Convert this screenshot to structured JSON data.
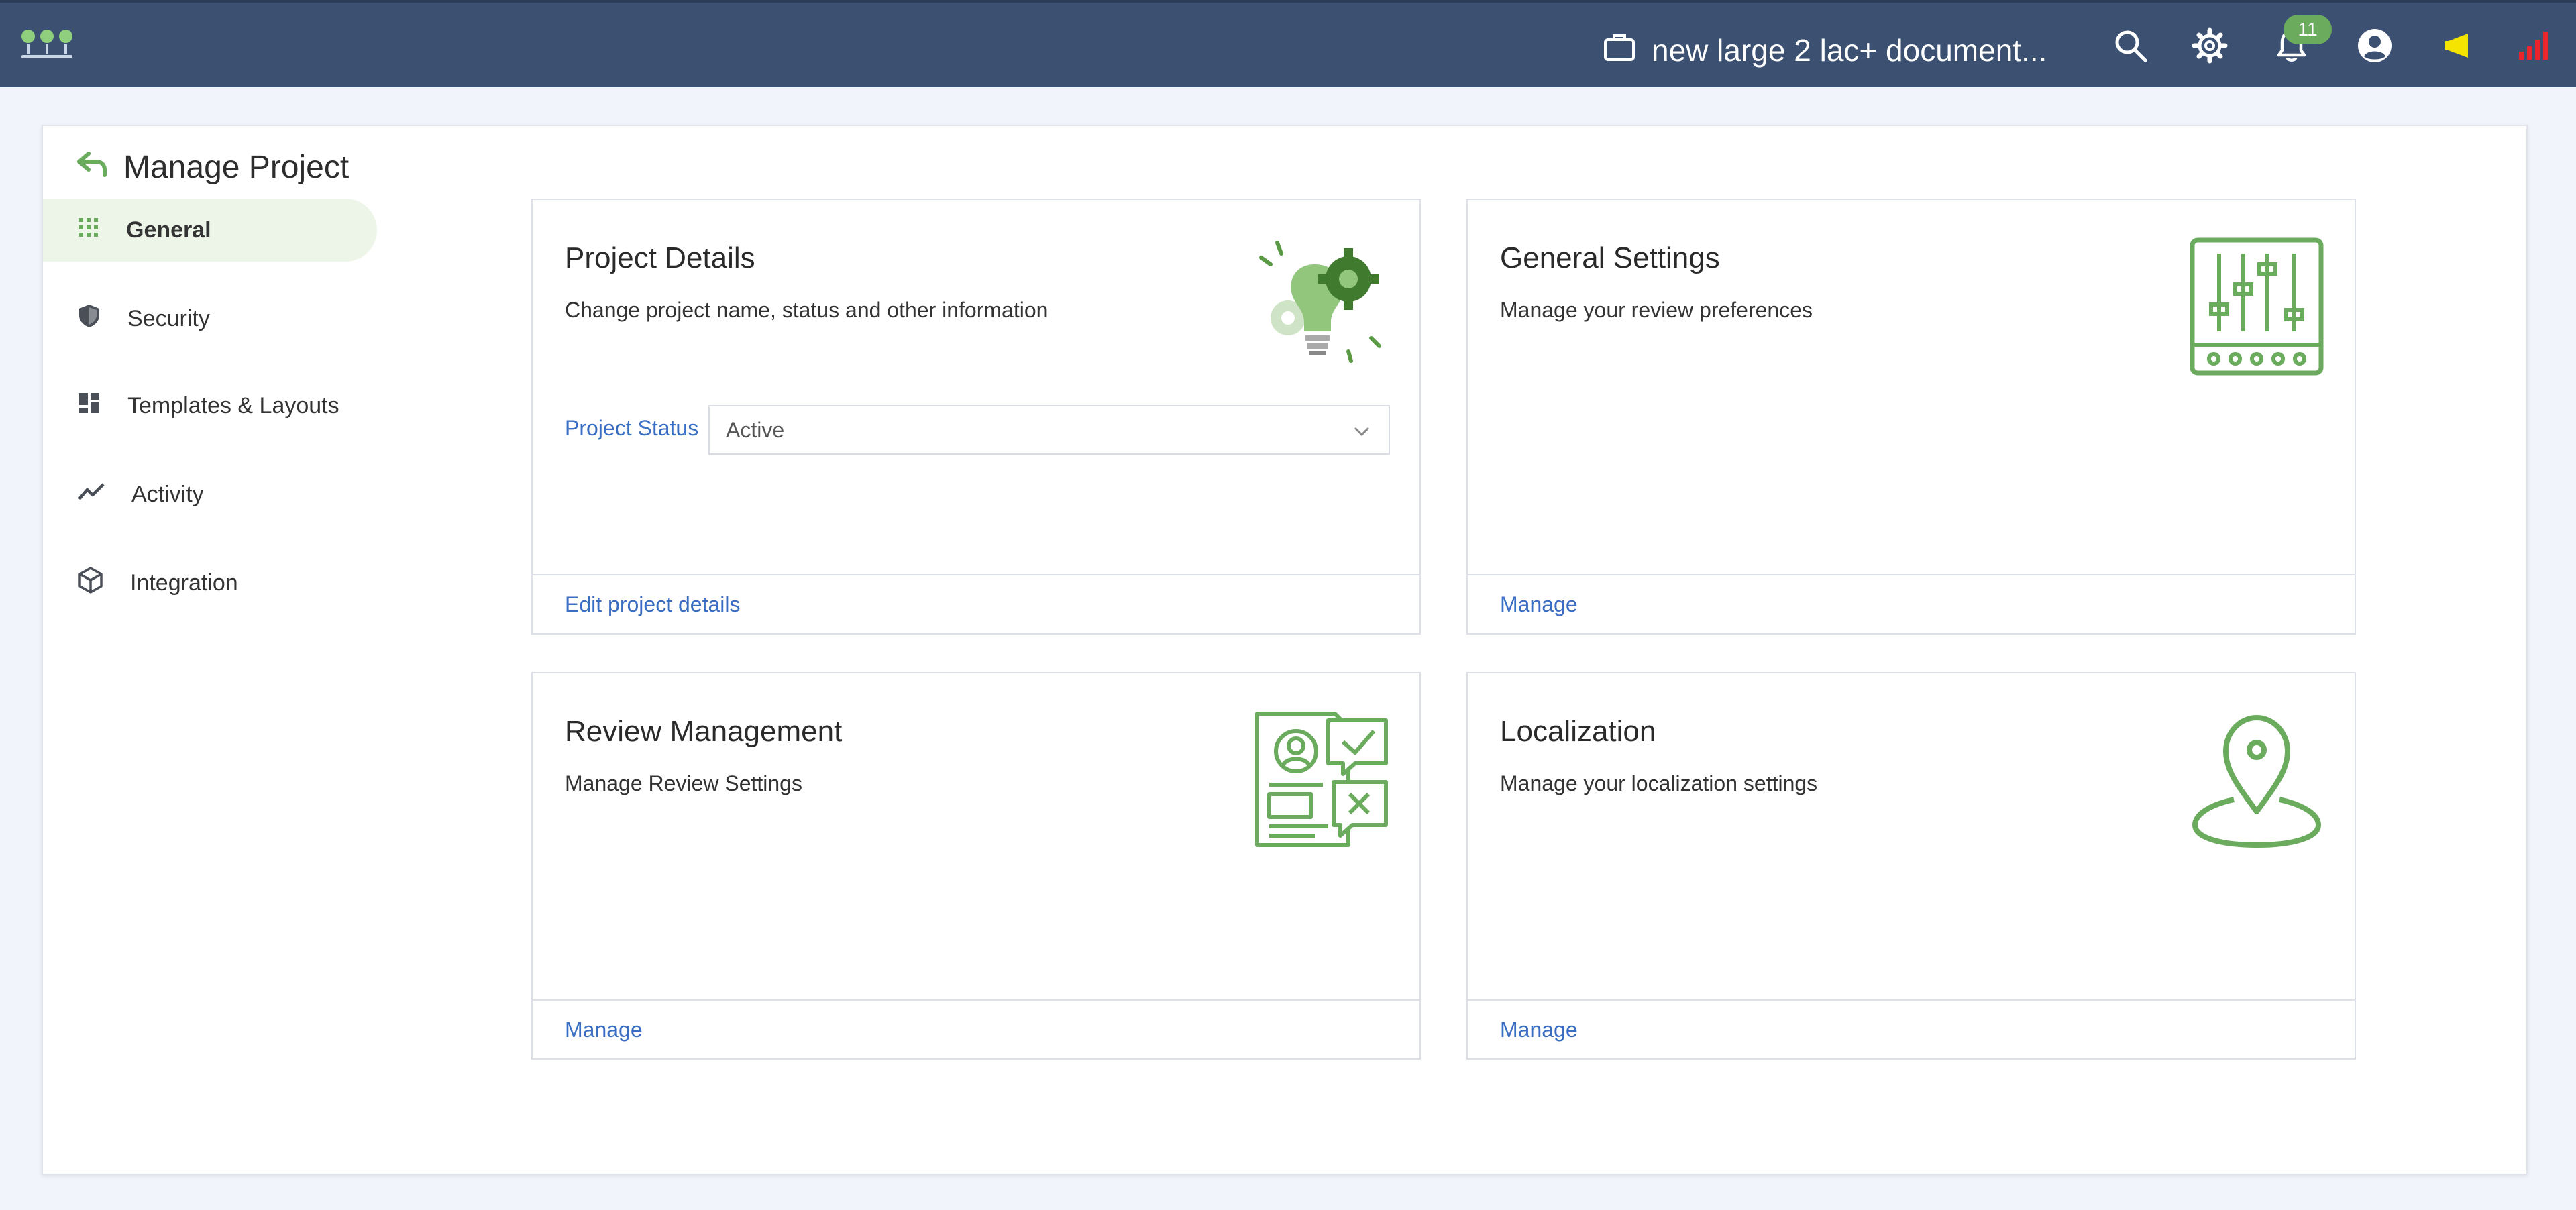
{
  "topbar": {
    "project_name": "new large 2 lac+ document...",
    "notification_count": "11",
    "icons": [
      "logo-icon",
      "briefcase-icon",
      "search-icon",
      "gear-icon",
      "bell-icon",
      "user-icon",
      "megaphone-icon",
      "signal-icon"
    ]
  },
  "page": {
    "title": "Manage Project"
  },
  "sidebar": {
    "items": [
      {
        "label": "General",
        "icon": "grid-icon",
        "active": true
      },
      {
        "label": "Security",
        "icon": "shield-icon"
      },
      {
        "label": "Templates & Layouts",
        "icon": "layout-icon"
      },
      {
        "label": "Activity",
        "icon": "activity-icon"
      },
      {
        "label": "Integration",
        "icon": "cube-icon"
      }
    ]
  },
  "cards": {
    "project_details": {
      "title": "Project Details",
      "description": "Change project name, status and other information",
      "status_label": "Project Status",
      "status_value": "Active",
      "footer_link": "Edit project details"
    },
    "general_settings": {
      "title": "General Settings",
      "description": "Manage your review preferences",
      "footer_link": "Manage"
    },
    "review_management": {
      "title": "Review Management",
      "description": "Manage Review Settings",
      "footer_link": "Manage"
    },
    "localization": {
      "title": "Localization",
      "description": "Manage your localization settings",
      "footer_link": "Manage"
    }
  },
  "colors": {
    "topbar": "#3c5171",
    "accent_green": "#6aab5d",
    "link_blue": "#3a6ec2"
  }
}
